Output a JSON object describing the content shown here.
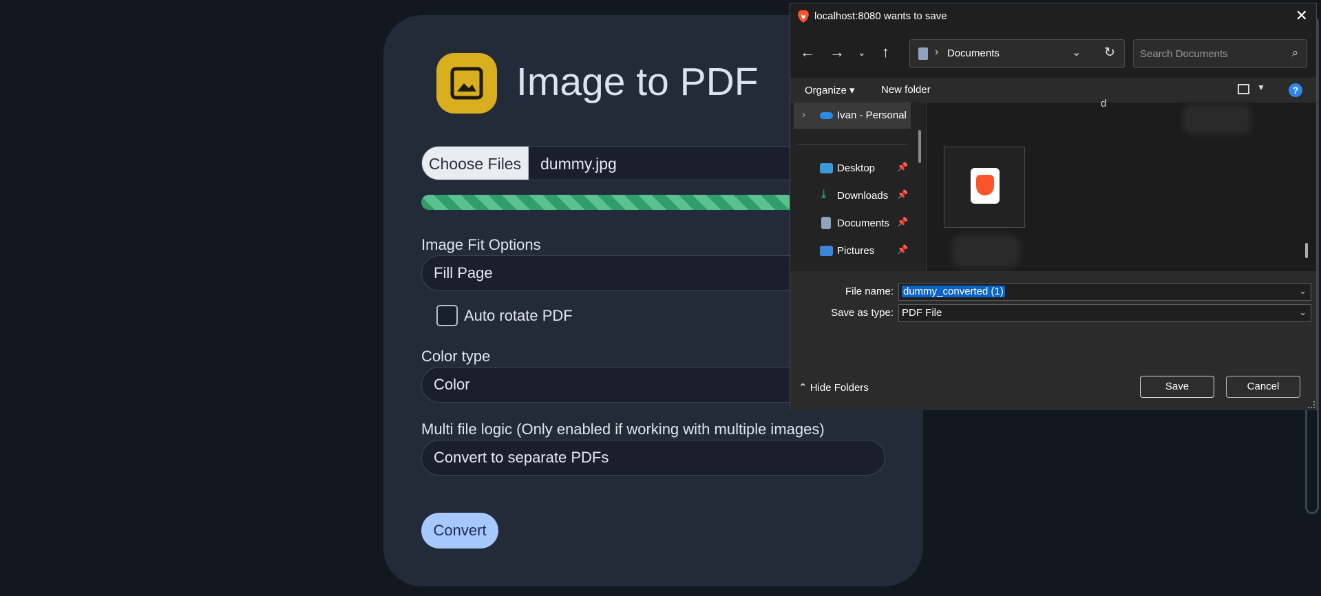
{
  "app": {
    "title": "Image to PDF",
    "choose_files_label": "Choose Files",
    "selected_file": "dummy.jpg",
    "upload_progress": 1.0,
    "fit_label": "Image Fit Options",
    "fit_value": "Fill Page",
    "auto_rotate_label": "Auto rotate PDF",
    "auto_rotate_checked": false,
    "color_label": "Color type",
    "color_value": "Color",
    "multi_label": "Multi file logic (Only enabled if working with multiple images)",
    "multi_value": "Convert to separate PDFs",
    "convert_label": "Convert",
    "accent": "#d9ae1f"
  },
  "dialog": {
    "title": "localhost:8080 wants to save",
    "close": "✕",
    "breadcrumb": "Documents",
    "search_placeholder": "Search Documents",
    "toolbar": {
      "organize": "Organize ▾",
      "new_folder": "New folder",
      "help": "?"
    },
    "nav_items": [
      {
        "label": "Ivan - Personal",
        "icon": "onedrive-icon"
      },
      {
        "label": "Desktop",
        "icon": "desktop-icon"
      },
      {
        "label": "Downloads",
        "icon": "download-icon"
      },
      {
        "label": "Documents",
        "icon": "documents-icon"
      },
      {
        "label": "Pictures",
        "icon": "pictures-icon"
      }
    ],
    "file_pane_text": "d",
    "file_name_label": "File name:",
    "file_name_value": "dummy_converted (1)",
    "save_type_label": "Save as type:",
    "save_type_value": "PDF File",
    "hide_folders": "Hide Folders",
    "save_label": "Save",
    "cancel_label": "Cancel"
  }
}
